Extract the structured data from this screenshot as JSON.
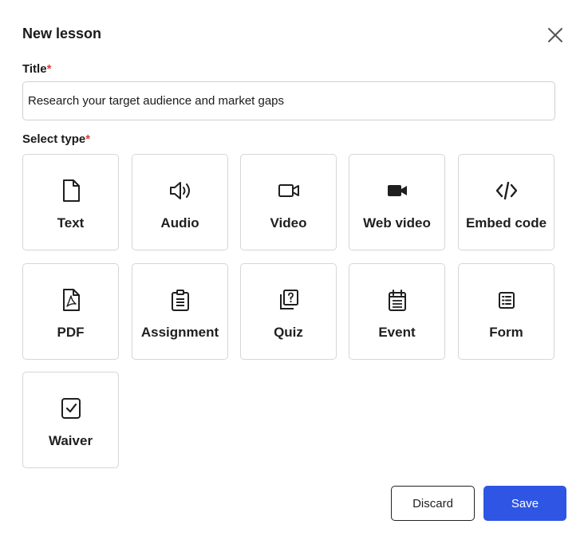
{
  "dialog": {
    "title": "New lesson",
    "close_icon": "close-icon"
  },
  "form": {
    "title_label": "Title",
    "required_mark": "*",
    "title_value": "Research your target audience and market gaps",
    "type_label": "Select type"
  },
  "types": [
    {
      "label": "Text",
      "icon": "file-icon"
    },
    {
      "label": "Audio",
      "icon": "speaker-icon"
    },
    {
      "label": "Video",
      "icon": "video-camera-outline-icon"
    },
    {
      "label": "Web video",
      "icon": "video-camera-filled-icon"
    },
    {
      "label": "Embed code",
      "icon": "code-icon"
    },
    {
      "label": "PDF",
      "icon": "pdf-file-icon"
    },
    {
      "label": "Assignment",
      "icon": "clipboard-icon"
    },
    {
      "label": "Quiz",
      "icon": "quiz-icon"
    },
    {
      "label": "Event",
      "icon": "calendar-icon"
    },
    {
      "label": "Form",
      "icon": "form-list-icon"
    },
    {
      "label": "Waiver",
      "icon": "checkbox-icon"
    }
  ],
  "actions": {
    "discard": "Discard",
    "save": "Save"
  },
  "colors": {
    "primary": "#2f55e4",
    "required": "#e0393e",
    "border": "#d6d6d6"
  }
}
